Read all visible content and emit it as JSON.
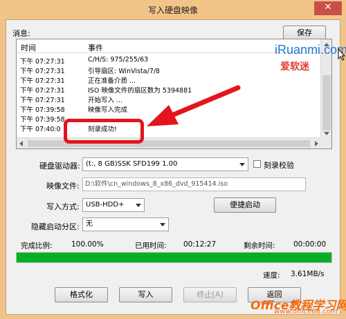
{
  "window": {
    "title": "写入硬盘映像",
    "close_glyph": "✕"
  },
  "log": {
    "label": "消息:",
    "save_label": "保存",
    "columns": {
      "time": "时间",
      "event": "事件"
    },
    "rows": [
      {
        "time": "下午 07:27:31",
        "event": "C/H/S: 975/255/63"
      },
      {
        "time": "下午 07:27:31",
        "event": "引导扇区: WinVista/7/8"
      },
      {
        "time": "下午 07:27:31",
        "event": "正在准备介质 ..."
      },
      {
        "time": "下午 07:27:31",
        "event": "ISO 映像文件的扇区数为 5394881"
      },
      {
        "time": "下午 07:27:31",
        "event": "开始写入 ..."
      },
      {
        "time": "下午 07:39:58",
        "event": "映像写入完成"
      },
      {
        "time": "下午 07:39:58",
        "event": ""
      },
      {
        "time": "下午 07:40:0",
        "event": "刻录成功!"
      }
    ]
  },
  "watermark": {
    "logo": "iRuanmi.com",
    "sub": "爱软迷"
  },
  "form": {
    "drive_label": "硬盘驱动器:",
    "drive_value": "(t:, 8 GB)SSK      SFD199           1.00",
    "verify_label": "刻录校验",
    "verify_checked": false,
    "image_label": "映像文件:",
    "image_value": "D:\\软件\\cn_windows_8_x86_dvd_915414.iso",
    "write_mode_label": "写入方式:",
    "write_mode_value": "USB-HDD+",
    "quick_boot_label": "便捷启动",
    "hidden_partition_label": "隐藏启动分区:",
    "hidden_partition_value": "无"
  },
  "stats": {
    "percent_label": "完成比例:",
    "percent_value": "100.00%",
    "elapsed_label": "已用时间:",
    "elapsed_value": "00:12:27",
    "remaining_label": "剩余时间:",
    "remaining_value": "00:00:00",
    "speed_label": "速度:",
    "speed_value": "3.61MB/s",
    "progress_fraction": 1.0
  },
  "buttons": {
    "format": "格式化",
    "write": "写入",
    "abort": "终止[A]",
    "back": "返回"
  },
  "site_watermark": {
    "main": "Office教程学习网",
    "url": "www.office68.com"
  },
  "colors": {
    "progress": "#06b025",
    "highlight": "#e3151b",
    "frame": "#f2c488"
  }
}
